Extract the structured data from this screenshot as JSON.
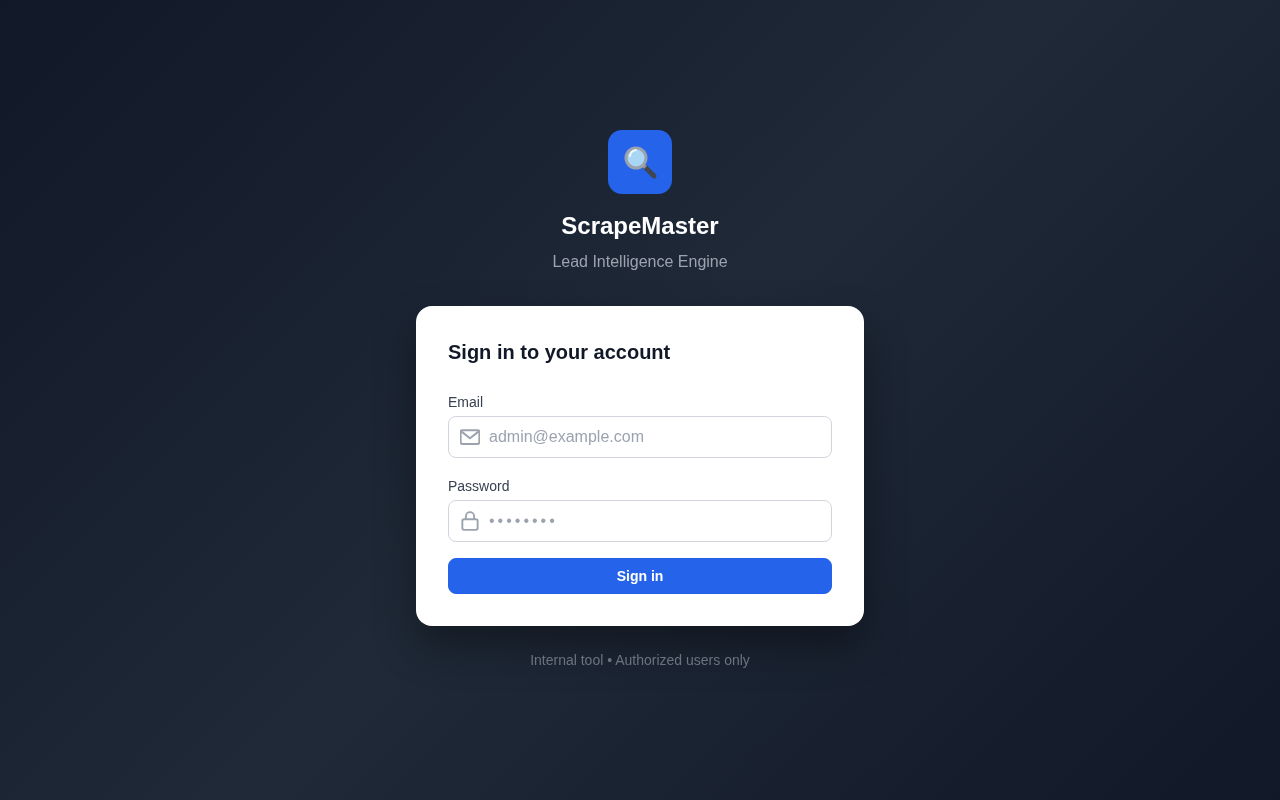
{
  "brand": {
    "title": "ScrapeMaster",
    "subtitle": "Lead Intelligence Engine"
  },
  "card": {
    "heading": "Sign in to your account",
    "fields": [
      {
        "kind": "email",
        "label": "Email",
        "placeholder": "admin@example.com"
      },
      {
        "kind": "password",
        "label": "Password",
        "placeholder": "••••••••"
      }
    ],
    "submit": "Sign in"
  },
  "footer": "Internal tool • Authorized users only"
}
